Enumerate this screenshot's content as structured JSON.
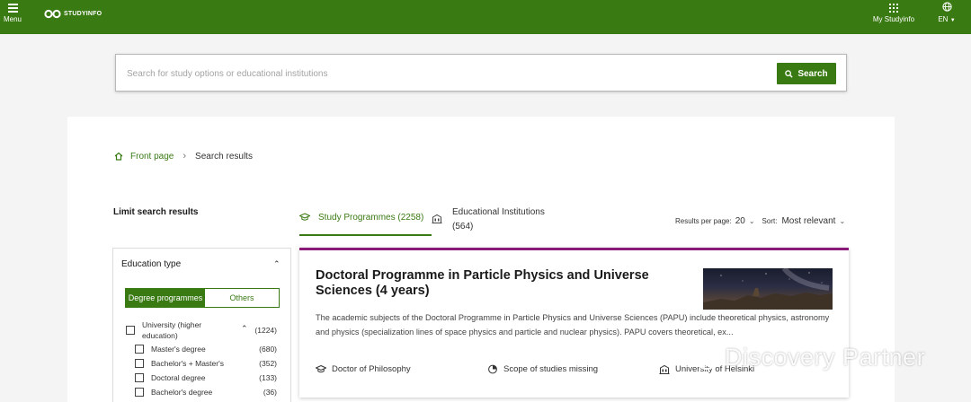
{
  "header": {
    "menu_label": "Menu",
    "logo_text": "STUDYINFO",
    "my_studyinfo": "My Studyinfo",
    "language": "EN"
  },
  "search": {
    "placeholder": "Search for study options or educational institutions",
    "button_label": "Search"
  },
  "breadcrumb": {
    "home": "Front page",
    "current": "Search results"
  },
  "sidebar": {
    "title": "Limit search results",
    "filter_title": "Education type",
    "toggle": {
      "active": "Degree programmes",
      "inactive": "Others"
    },
    "group": {
      "label": "University (higher education)",
      "count": "(1224)"
    },
    "options": [
      {
        "label": "Master's degree",
        "count": "(680)"
      },
      {
        "label": "Bachelor's + Master's",
        "count": "(352)"
      },
      {
        "label": "Doctoral degree",
        "count": "(133)"
      },
      {
        "label": "Bachelor's degree",
        "count": "(36)"
      }
    ]
  },
  "tabs": [
    {
      "label": "Study Programmes (2258)",
      "active": true
    },
    {
      "label": "Educational Institutions (564)",
      "active": false
    }
  ],
  "results_controls": {
    "per_page_label": "Results per page:",
    "per_page_value": "20",
    "sort_label": "Sort:",
    "sort_value": "Most relevant"
  },
  "result": {
    "title": "Doctoral Programme in Particle Physics and Universe Sciences (4 years)",
    "description": "The academic subjects of the Doctoral Programme in Particle Physics and Universe Sciences (PAPU) include theoretical physics, astronomy and physics (specialization lines of space physics and particle and nuclear physics). PAPU covers theoretical, ex...",
    "degree": "Doctor of Philosophy",
    "scope": "Scope of studies missing",
    "institution": "University of Helsinki"
  },
  "watermark": "Discovery Partner",
  "colors": {
    "brand_green": "#3a7a13",
    "accent_purple": "#8a1a7a"
  }
}
